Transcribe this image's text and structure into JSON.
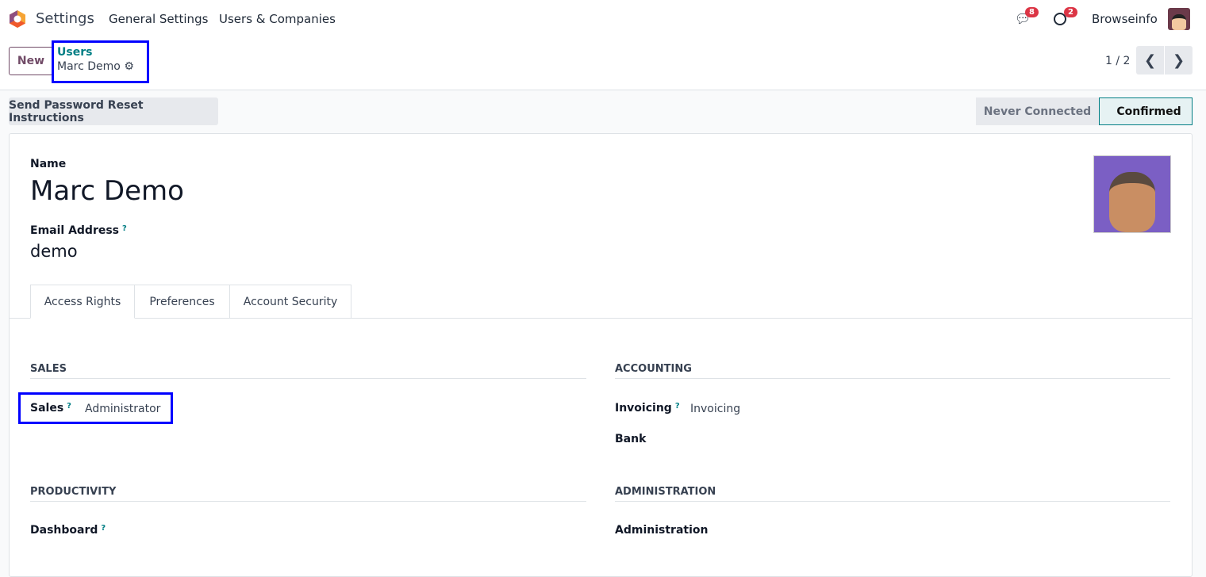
{
  "nav": {
    "app": "Settings",
    "menu": [
      "General Settings",
      "Users & Companies"
    ],
    "messages_count": "8",
    "activities_count": "2",
    "company": "Browseinfo"
  },
  "control": {
    "new": "New",
    "breadcrumb_parent": "Users",
    "breadcrumb_current": "Marc Demo",
    "pager": "1 / 2"
  },
  "actions": {
    "reset": "Send Password Reset Instructions",
    "status": [
      "Never Connected",
      "Confirmed"
    ]
  },
  "form": {
    "name_label": "Name",
    "name": "Marc Demo",
    "email_label": "Email Address",
    "email": "demo",
    "help": "?",
    "tabs": [
      "Access Rights",
      "Preferences",
      "Account Security"
    ],
    "sections": {
      "sales": "SALES",
      "accounting": "ACCOUNTING",
      "productivity": "PRODUCTIVITY",
      "administration": "ADMINISTRATION"
    },
    "fields": {
      "sales_label": "Sales",
      "sales_value": "Administrator",
      "invoicing_label": "Invoicing",
      "invoicing_value": "Invoicing",
      "bank_label": "Bank",
      "dashboard_label": "Dashboard",
      "administration_label": "Administration"
    }
  }
}
